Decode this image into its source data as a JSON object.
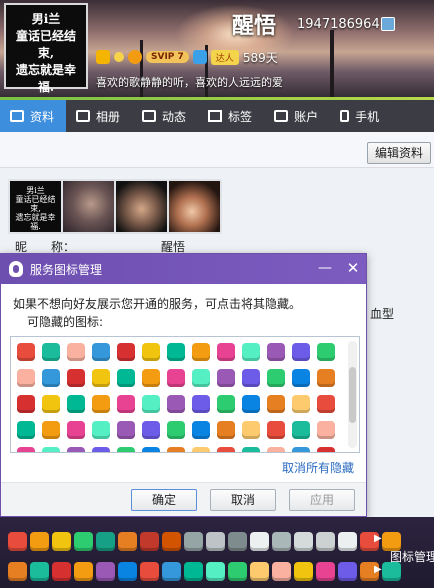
{
  "profile": {
    "avatar_text": [
      "男i兰",
      "童话已经结",
      "束,",
      "遗忘就是幸",
      "福."
    ],
    "nickname": "醒悟",
    "qq_number": "1947186964",
    "svip": "SVIP 7",
    "talent": "达人",
    "days": "589天",
    "signature": "喜欢的歌静静的听，喜欢的人远远的爱"
  },
  "nav": {
    "tabs": [
      {
        "label": "资料",
        "icon": "profile-card-icon"
      },
      {
        "label": "相册",
        "icon": "photo-album-icon"
      },
      {
        "label": "动态",
        "icon": "feed-list-icon"
      },
      {
        "label": "标签",
        "icon": "bookmark-icon"
      },
      {
        "label": "账户",
        "icon": "wallet-icon"
      },
      {
        "label": "手机",
        "icon": "phone-icon"
      }
    ]
  },
  "edit_button": "编辑资料",
  "info": {
    "nick_label": "昵　　称：",
    "nick_value": "醒悟",
    "blood_partial": "血型"
  },
  "photo_avatar_text": [
    "男i兰",
    "童话已经结",
    "束,",
    "遗忘就是幸",
    "福."
  ],
  "dialog": {
    "title": "服务图标管理",
    "description": "如果不想向好友展示您开通的服务，可点击将其隐藏。",
    "subtitle": "可隐藏的图标:",
    "unhide_all": "取消所有隐藏",
    "ok": "确定",
    "cancel": "取消",
    "apply": "应用",
    "icon_colors": [
      "#e74c3c",
      "#f39c12",
      "#e67e22",
      "#f1c40f",
      "#2ecc71",
      "#3498db",
      "#9b59b6",
      "#1abc9c",
      "#e84393",
      "#fdcb6e",
      "#00b894",
      "#0984e3",
      "#d63031",
      "#6c5ce7",
      "#fab1a0",
      "#55efc4"
    ]
  },
  "bottom_bar": {
    "manage_label": "图标管理",
    "row_icon_colors": [
      "#e74c3c",
      "#f39c12",
      "#f1c40f",
      "#2ecc71",
      "#16a085",
      "#e67e22",
      "#c0392b",
      "#d35400",
      "#95a5a6",
      "#bdc3c7",
      "#7f8c8d",
      "#ecf0f1",
      "#aab7b8",
      "#d5dbdb",
      "#ccd1d1",
      "#ecf0f1"
    ]
  }
}
